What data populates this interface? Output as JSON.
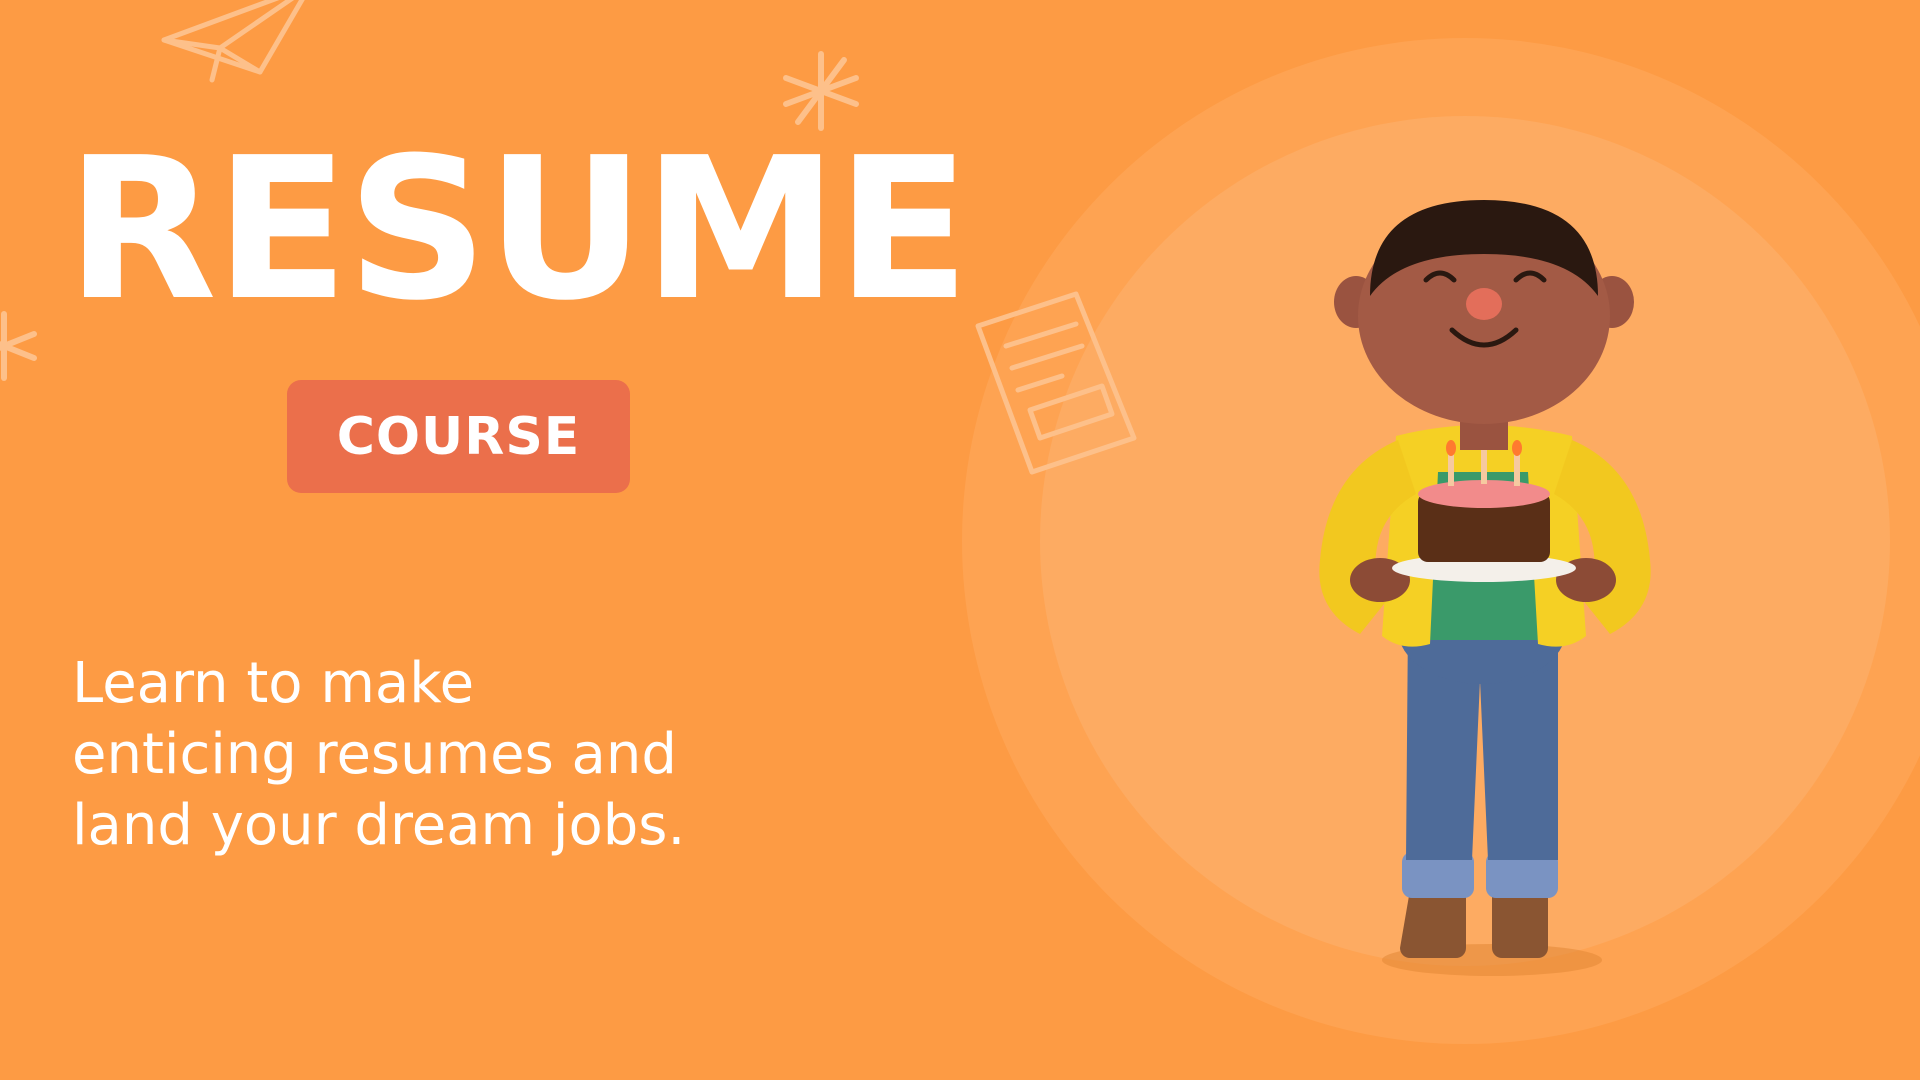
{
  "slide": {
    "title": "RESUME",
    "badge": "COURSE",
    "tagline": "Learn to make enticing resumes and land your dream jobs."
  },
  "colors": {
    "background": "#fd9b44",
    "circle_outer": "#fea352",
    "circle_inner": "#fdab62",
    "badge": "#eb6f4b",
    "text": "#ffffff"
  },
  "icons": {
    "paper_plane": "paper-plane-icon",
    "asterisk": "asterisk-icon",
    "document": "document-icon"
  }
}
